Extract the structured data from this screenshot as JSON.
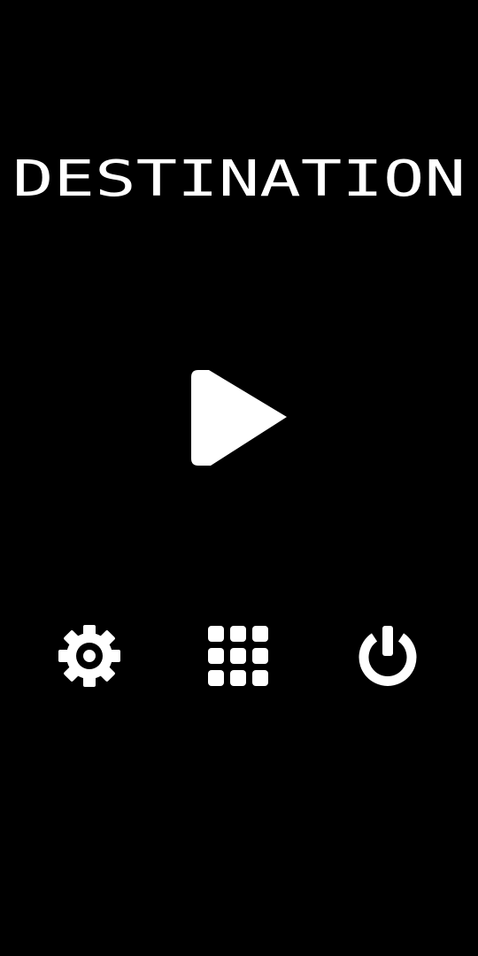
{
  "app": {
    "title": "DESTINATION",
    "background_color": "#000000",
    "foreground_color": "#ffffff"
  },
  "main_menu": {
    "play_icon": "play-icon",
    "buttons": [
      {
        "id": "settings",
        "icon": "gear-icon"
      },
      {
        "id": "levels",
        "icon": "grid-icon"
      },
      {
        "id": "quit",
        "icon": "power-icon"
      }
    ]
  }
}
